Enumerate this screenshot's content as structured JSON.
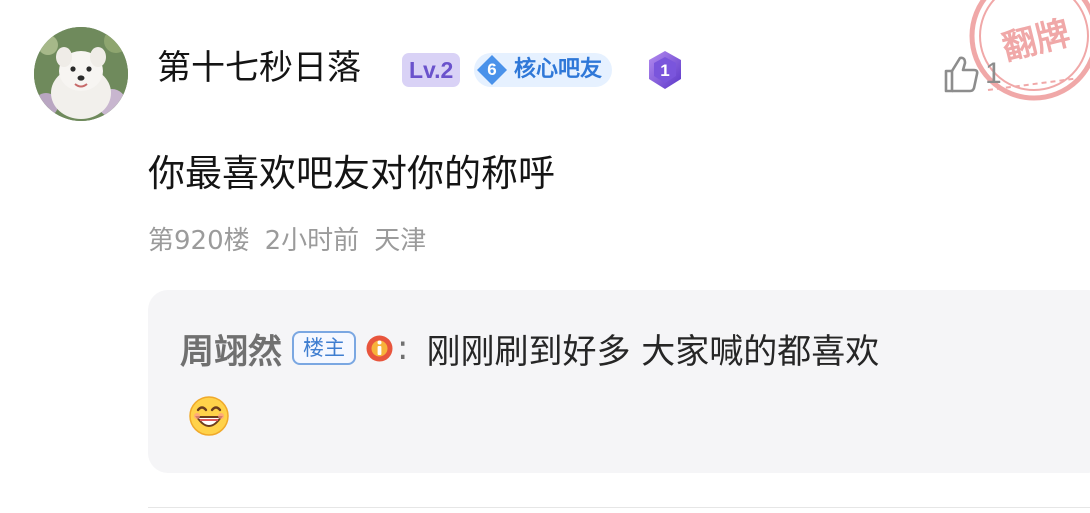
{
  "post": {
    "author": {
      "name": "第十七秒日落",
      "level": "Lv.2",
      "core_badge_number": "6",
      "core_badge_label": "核心吧友",
      "medal_number": "1"
    },
    "like_count": "1",
    "stamp_text": "翻牌",
    "content": "你最喜欢吧友对你的称呼",
    "meta": {
      "floor": "第920楼",
      "time": "2小时前",
      "location": "天津"
    },
    "reply": {
      "author": "周翊然",
      "role_badge": "楼主",
      "colon": ":",
      "text": "刚刚刷到好多 大家喊的都喜欢",
      "emoji": "grinning-face-icon"
    }
  },
  "colors": {
    "level_badge_bg": "#d9d2f6",
    "level_badge_text": "#6a52cc",
    "core_badge_bg": "#e6f1ff",
    "core_badge_text": "#2f78d8",
    "stamp": "#e04040",
    "meta_text": "#9b9b9b",
    "reply_bg": "#f5f5f7"
  }
}
